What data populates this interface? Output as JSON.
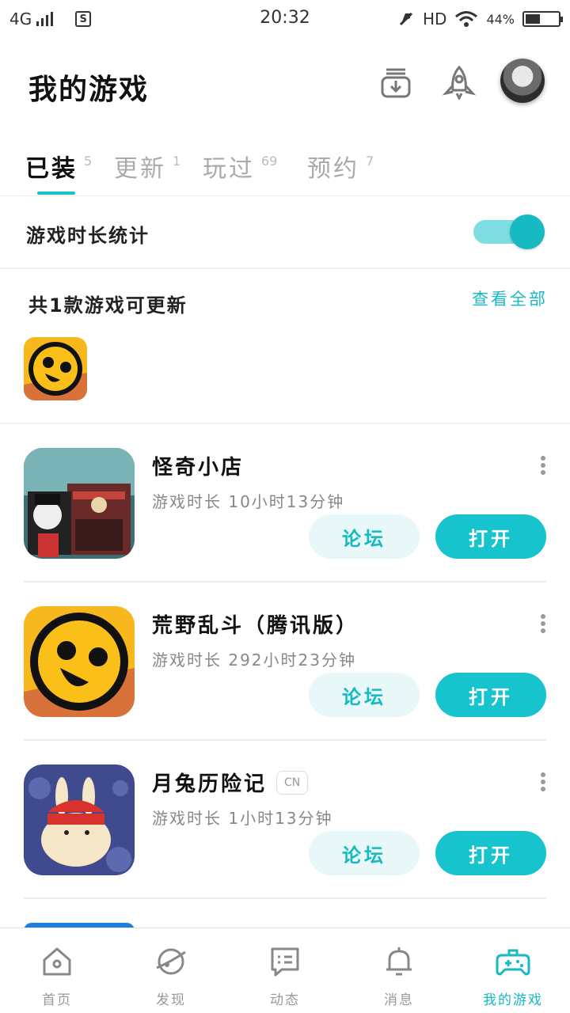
{
  "status_bar": {
    "network": "4G",
    "time": "20:32",
    "hd": "HD",
    "battery_text": "44%",
    "battery_level": 0.44
  },
  "header": {
    "title": "我的游戏",
    "icons": [
      "download-icon",
      "rocket-icon",
      "avatar"
    ]
  },
  "tabs": [
    {
      "label": "已装",
      "count": "5",
      "active": true
    },
    {
      "label": "更新",
      "count": "1",
      "active": false
    },
    {
      "label": "玩过",
      "count": "69",
      "active": false
    },
    {
      "label": "预约",
      "count": "7",
      "active": false
    }
  ],
  "playtime_stats": {
    "label": "游戏时长统计",
    "enabled": true
  },
  "updates": {
    "title": "共1款游戏可更新",
    "view_all": "查看全部"
  },
  "games": [
    {
      "name": "怪奇小店",
      "tag": "",
      "playtime": "游戏时长 10小时13分钟",
      "forum": "论坛",
      "open": "打开"
    },
    {
      "name": "荒野乱斗（腾讯版）",
      "tag": "",
      "playtime": "游戏时长 292小时23分钟",
      "forum": "论坛",
      "open": "打开"
    },
    {
      "name": "月兔历险记",
      "tag": "CN",
      "playtime": "游戏时长 1小时13分钟",
      "forum": "论坛",
      "open": "打开"
    }
  ],
  "bottom_nav": [
    {
      "label": "首页",
      "icon": "home-icon",
      "active": false
    },
    {
      "label": "发现",
      "icon": "planet-icon",
      "active": false
    },
    {
      "label": "动态",
      "icon": "chat-icon",
      "active": false
    },
    {
      "label": "消息",
      "icon": "bell-icon",
      "active": false
    },
    {
      "label": "我的游戏",
      "icon": "gamepad-icon",
      "active": true
    }
  ],
  "colors": {
    "accent": "#17c3cc",
    "accent_light": "#e8f8f9",
    "text": "#222222",
    "muted": "#999999"
  }
}
